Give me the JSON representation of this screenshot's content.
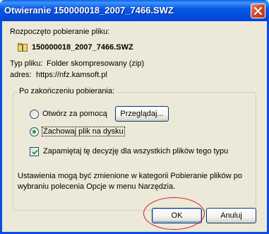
{
  "window": {
    "title": "Otwieranie 150000018_2007_7466.SWZ"
  },
  "download": {
    "started_text": "Rozpoczęto pobieranie pliku:",
    "file_name": "150000018_2007_7466.SWZ",
    "type_label": "Typ pliku:",
    "type_value": "Folder skompresowany (zip)",
    "address_label": "adres:",
    "address_value": "https://nfz.kamsoft.pl"
  },
  "after_download": {
    "legend": "Po zakończeniu pobierania:",
    "open_with_label": "Otwórz za pomocą",
    "browse_button": "Przeglądaj...",
    "save_label": "Zachowaj plik na dysku",
    "remember_label": "Zapamiętaj tę decyzję dla wszystkich plików tego typu",
    "selected_option": "save",
    "remember_checked": true
  },
  "info": {
    "line1": "Ustawienia mogą być zmienione w kategorii Pobieranie plików po",
    "line2": "wybraniu polecenia Opcje w menu Narzędzia."
  },
  "buttons": {
    "ok": "OK",
    "cancel": "Anuluj"
  },
  "colors": {
    "titlebar": "#0054e3",
    "dialog_bg": "#ece9d8",
    "radio_dot": "#21a121",
    "annotation": "#d41b1b"
  },
  "icons": {
    "file": "zip-folder-icon",
    "close": "close-icon"
  }
}
